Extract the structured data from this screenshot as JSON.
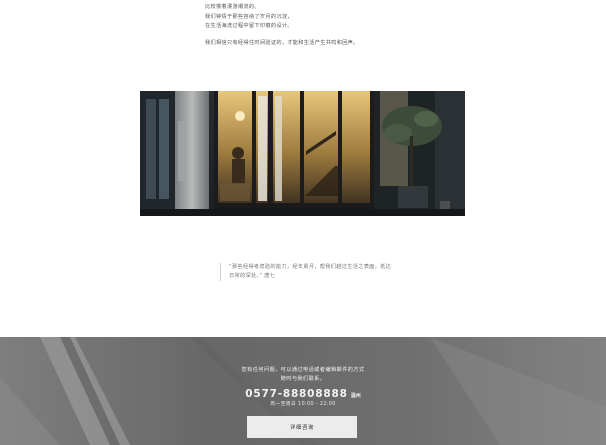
{
  "intro": {
    "lines": [
      "比较慢着漫游潮流的。",
      "我们钟情于那些容纳了岁月的沉淀，",
      "在生活海洗过程中留下印痕的设计。"
    ],
    "closing": "我们相信只有经得住时间验证的，才能和生活产生共鸣和回声。"
  },
  "quote": {
    "text": "“那些经得考虑验的能力，经年累月，帮我们越过生活之表面，抵达日常的深处。” 唐七"
  },
  "footer": {
    "contact_line1": "您有任何问题，可以通过电话或者编辑邮件的方式",
    "contact_line2": "随时与我们联系。",
    "phone": "0577-88808888",
    "city": "温州",
    "hours": "周一至周日 10:00 - 22:00",
    "button_label": "详细咨询"
  }
}
